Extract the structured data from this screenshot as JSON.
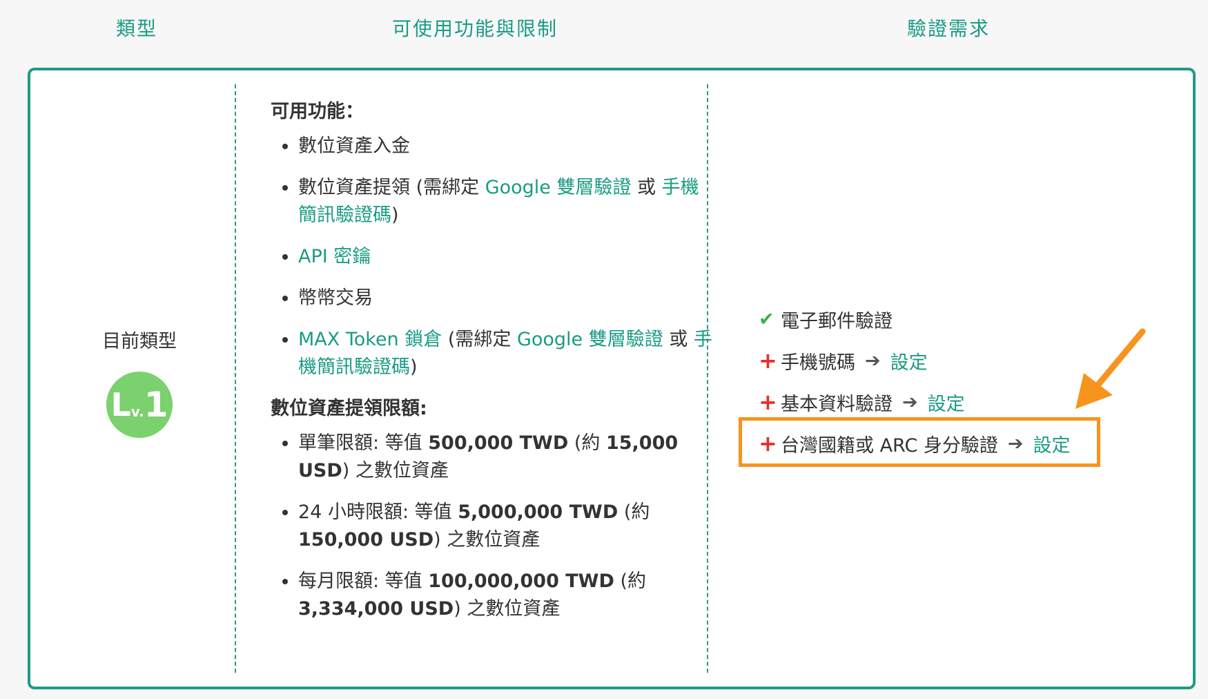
{
  "headers": {
    "type": "類型",
    "features": "可使用功能與限制",
    "requirements": "驗證需求"
  },
  "level": {
    "current_label": "目前類型",
    "badge_l": "L",
    "badge_v": "v.",
    "badge_n": "1"
  },
  "features": {
    "available_title": "可用功能：",
    "items": [
      {
        "t1": "數位資產入金"
      },
      {
        "t1": "數位資產提領 (需綁定 ",
        "l1": "Google 雙層驗證",
        "t2": " 或 ",
        "l2": "手機簡訊驗證碼",
        "t3": ")"
      },
      {
        "l1": "API 密鑰"
      },
      {
        "t1": "幣幣交易"
      },
      {
        "l0": "MAX Token 鎖倉",
        "t1": " (需綁定 ",
        "l1": "Google 雙層驗證",
        "t2": " 或 ",
        "l2": "手機簡訊驗證碼",
        "t3": ")"
      }
    ],
    "limits_title": "數位資產提領限額:",
    "limits": [
      {
        "pre": "單筆限額: 等值 ",
        "b1": "500,000 TWD",
        "mid": " (約 ",
        "b2": "15,000 USD",
        "post": ") 之數位資產"
      },
      {
        "pre": "24 小時限額: 等值 ",
        "b1": "5,000,000 TWD",
        "mid": " (約 ",
        "b2": "150,000 USD",
        "post": ") 之數位資產"
      },
      {
        "pre": "每月限額: 等值 ",
        "b1": "100,000,000 TWD",
        "mid": " (約 ",
        "b2": "3,334,000 USD",
        "post": ") 之數位資產"
      }
    ]
  },
  "requirements": {
    "items": [
      {
        "label": "電子郵件驗證",
        "status": "done"
      },
      {
        "label": "手機號碼",
        "action": "設定"
      },
      {
        "label": "基本資料驗證",
        "action": "設定"
      },
      {
        "label": "台灣國籍或 ARC 身分驗證",
        "action": "設定"
      }
    ]
  },
  "colors": {
    "accent": "#1a9b85",
    "check": "#36b34a",
    "plus": "#e8302b",
    "highlight": "#f7941d",
    "badge": "#7bd16d"
  }
}
